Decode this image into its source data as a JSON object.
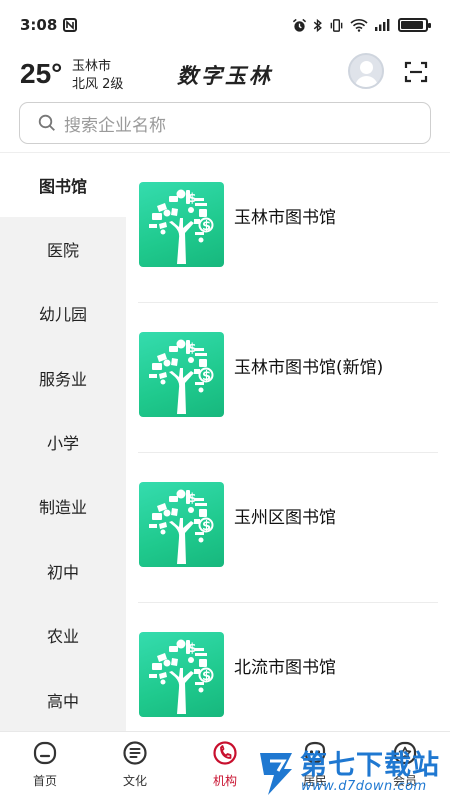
{
  "status_bar": {
    "time": "3:08",
    "battery_level": 0.9
  },
  "header": {
    "temperature": "25°",
    "city": "玉林市",
    "wind": "北风  2级",
    "app_title": "数字玉林"
  },
  "search": {
    "placeholder": "搜索企业名称"
  },
  "categories": [
    {
      "label": "图书馆",
      "active": true
    },
    {
      "label": "医院",
      "active": false
    },
    {
      "label": "幼儿园",
      "active": false
    },
    {
      "label": "服务业",
      "active": false
    },
    {
      "label": "小学",
      "active": false
    },
    {
      "label": "制造业",
      "active": false
    },
    {
      "label": "初中",
      "active": false
    },
    {
      "label": "农业",
      "active": false
    },
    {
      "label": "高中",
      "active": false
    }
  ],
  "organizations": [
    {
      "name": "玉林市图书馆"
    },
    {
      "name": "玉林市图书馆(新馆)"
    },
    {
      "name": "玉州区图书馆"
    },
    {
      "name": "北流市图书馆"
    }
  ],
  "bottom_nav": [
    {
      "label": "首页",
      "icon": "home-icon",
      "active": false
    },
    {
      "label": "文化",
      "icon": "culture-icon",
      "active": false
    },
    {
      "label": "机构",
      "icon": "institution-icon",
      "active": true
    },
    {
      "label": "居民",
      "icon": "resident-icon",
      "active": false
    },
    {
      "label": "会员",
      "icon": "member-icon",
      "active": false
    }
  ],
  "watermark": {
    "title": "第七下载站",
    "url": "www.d7down.com"
  },
  "colors": {
    "accent": "#c8102e",
    "thumb_green": "#1fc98d",
    "watermark_blue": "#1f78d1"
  }
}
